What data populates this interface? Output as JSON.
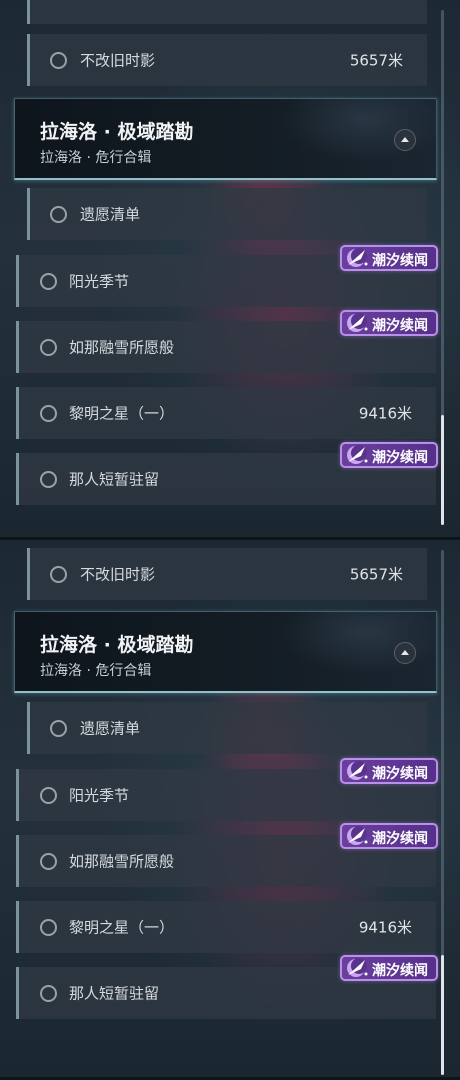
{
  "panels": [
    {
      "top_row": {
        "label": "不改旧时影",
        "distance": "5657米"
      },
      "region": {
        "title": "拉海洛 · 极域踏勘",
        "subtitle": "拉海洛 · 危行合辑"
      },
      "sub_quest": {
        "label": "遗愿清单"
      },
      "quests": [
        {
          "label": "阳光季节",
          "distance": "",
          "badge": "潮汐续闻"
        },
        {
          "label": "如那融雪所愿般",
          "distance": "",
          "badge": "潮汐续闻"
        },
        {
          "label": "黎明之星（一）",
          "distance": "9416米",
          "badge": ""
        },
        {
          "label": "那人短暂驻留",
          "distance": "",
          "badge": "潮汐续闻"
        }
      ]
    },
    {
      "top_row": {
        "label": "不改旧时影",
        "distance": "5657米"
      },
      "region": {
        "title": "拉海洛 · 极域踏勘",
        "subtitle": "拉海洛 · 危行合辑"
      },
      "sub_quest": {
        "label": "遗愿清单"
      },
      "quests": [
        {
          "label": "阳光季节",
          "distance": "",
          "badge": "潮汐续闻"
        },
        {
          "label": "如那融雪所愿般",
          "distance": "",
          "badge": "潮汐续闻"
        },
        {
          "label": "黎明之星（一）",
          "distance": "9416米",
          "badge": ""
        },
        {
          "label": "那人短暂驻留",
          "distance": "",
          "badge": "潮汐续闻"
        }
      ]
    }
  ],
  "colors": {
    "badge": "#6b3fa0",
    "badge_border": "#b890e6",
    "accent": "#aadce6"
  },
  "icons": {
    "status": "circle-icon",
    "collapse": "chevron-up-icon",
    "badge": "tide-crescent-icon"
  }
}
